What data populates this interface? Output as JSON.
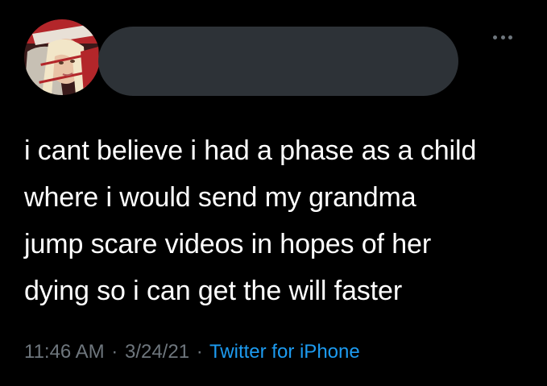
{
  "tweet": {
    "author": {
      "avatar_icon": "profile-photo",
      "name_redacted": true
    },
    "more_icon": "ellipsis-icon",
    "text_lines": [
      "i cant believe i had a phase as a child",
      "where i would send my grandma",
      "jump scare videos in hopes of her",
      "dying so i can get the will faster"
    ],
    "meta": {
      "time": "11:46 AM",
      "separator": "·",
      "date": "3/24/21",
      "source": "Twitter for iPhone"
    }
  },
  "colors": {
    "background": "#000000",
    "text": "#ffffff",
    "muted": "#6e767d",
    "link": "#1d9bf0",
    "redaction": "#2d3237"
  }
}
